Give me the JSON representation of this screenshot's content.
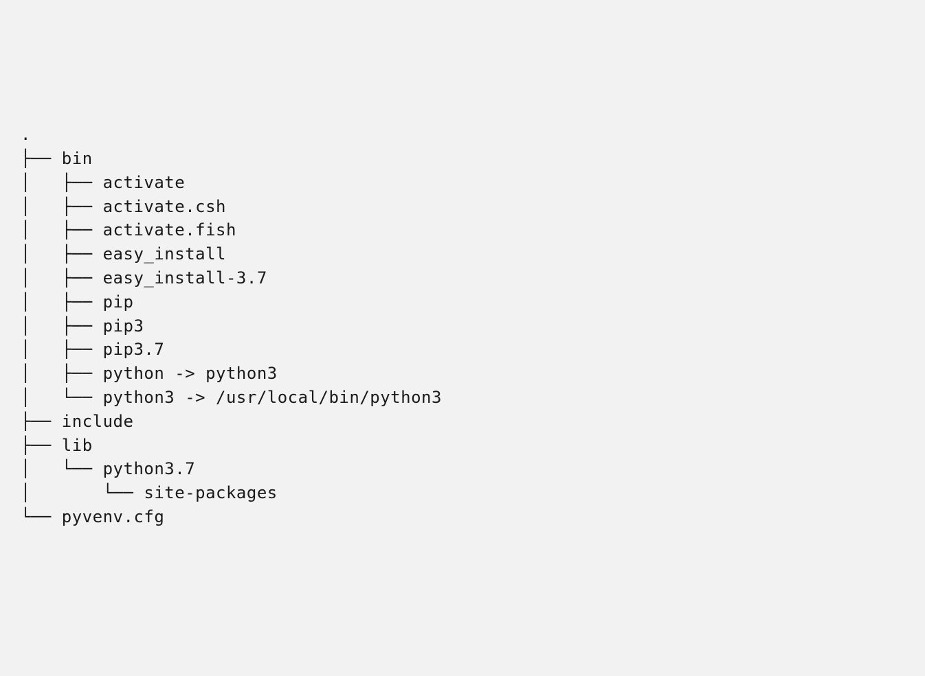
{
  "tree": {
    "root": ".",
    "lines": [
      {
        "prefix": "├── ",
        "name": "bin"
      },
      {
        "prefix": "│   ├── ",
        "name": "activate"
      },
      {
        "prefix": "│   ├── ",
        "name": "activate.csh"
      },
      {
        "prefix": "│   ├── ",
        "name": "activate.fish"
      },
      {
        "prefix": "│   ├── ",
        "name": "easy_install"
      },
      {
        "prefix": "│   ├── ",
        "name": "easy_install-3.7"
      },
      {
        "prefix": "│   ├── ",
        "name": "pip"
      },
      {
        "prefix": "│   ├── ",
        "name": "pip3"
      },
      {
        "prefix": "│   ├── ",
        "name": "pip3.7"
      },
      {
        "prefix": "│   ├── ",
        "name": "python -> python3"
      },
      {
        "prefix": "│   └── ",
        "name": "python3 -> /usr/local/bin/python3"
      },
      {
        "prefix": "├── ",
        "name": "include"
      },
      {
        "prefix": "├── ",
        "name": "lib"
      },
      {
        "prefix": "│   └── ",
        "name": "python3.7"
      },
      {
        "prefix": "│       └── ",
        "name": "site-packages"
      },
      {
        "prefix": "└── ",
        "name": "pyvenv.cfg"
      }
    ]
  }
}
